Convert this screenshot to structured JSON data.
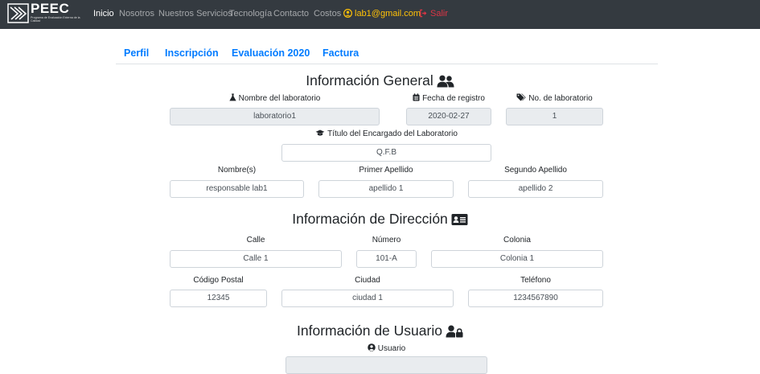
{
  "navbar": {
    "brand_title": "PEEC",
    "brand_subtitle": "Programa de Evaluación Externa de la Calidad",
    "items": [
      {
        "label": "Inicio"
      },
      {
        "label": "Nosotros"
      },
      {
        "label": "Nuestros Servicios"
      },
      {
        "label": "Tecnología"
      },
      {
        "label": "Contacto"
      },
      {
        "label": "Costos"
      }
    ],
    "email": "lab1@gmail.com",
    "logout": "Salir",
    "colors": {
      "background": "#343a40",
      "email": "#ffc107",
      "logout": "#dc3545"
    }
  },
  "tabs": [
    {
      "label": "Perfil"
    },
    {
      "label": "Inscripción"
    },
    {
      "label": "Evaluación 2020"
    },
    {
      "label": "Factura"
    }
  ],
  "general": {
    "heading": "Información General",
    "lab_name_label": "Nombre del laboratorio",
    "lab_name": "laboratorio1",
    "reg_date_label": "Fecha de registro",
    "reg_date": "2020-02-27",
    "lab_no_label": "No. de laboratorio",
    "lab_no": "1",
    "title_label": "Título del Encargado del Laboratorio",
    "title_value": "Q.F.B",
    "names_label": "Nombre(s)",
    "names_value": "responsable lab1",
    "surname1_label": "Primer Apellido",
    "surname1_value": "apellido 1",
    "surname2_label": "Segundo Apellido",
    "surname2_value": "apellido 2"
  },
  "address": {
    "heading": "Información de Dirección",
    "street_label": "Calle",
    "street_value": "Calle 1",
    "number_label": "Número",
    "number_value": "101-A",
    "colony_label": "Colonia",
    "colony_value": "Colonia 1",
    "zip_label": "Código Postal",
    "zip_value": "12345",
    "city_label": "Ciudad",
    "city_value": "ciudad 1",
    "phone_label": "Teléfono",
    "phone_value": "1234567890"
  },
  "user": {
    "heading": "Información de Usuario",
    "user_label": "Usuario"
  },
  "accent_color": "#007bff"
}
